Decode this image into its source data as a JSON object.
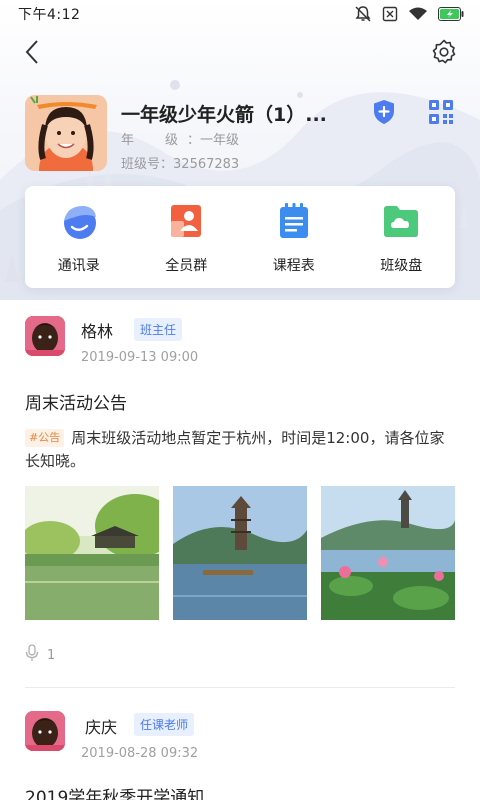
{
  "status_bar": {
    "time": "下午4:12",
    "icons": [
      "mute-icon",
      "no-sim-icon",
      "wifi-icon",
      "battery-charging-icon"
    ]
  },
  "header": {
    "back_icon": "chevron-left-icon",
    "settings_icon": "gear-icon"
  },
  "class_info": {
    "title": "一年级少年火箭（1）...",
    "grade_label": "年　级",
    "grade_value": "一年级",
    "number_label": "班级号",
    "number_value": "32567283",
    "shield_icon": "shield-plus-icon",
    "qr_icon": "qr-code-icon"
  },
  "quick_menu": [
    {
      "label": "通讯录",
      "icon": "contacts-icon",
      "color": "#4d7cf0"
    },
    {
      "label": "全员群",
      "icon": "group-chat-icon",
      "color": "#f2603f"
    },
    {
      "label": "课程表",
      "icon": "schedule-icon",
      "color": "#3c8df0"
    },
    {
      "label": "班级盘",
      "icon": "cloud-folder-icon",
      "color": "#4cc97a"
    }
  ],
  "posts": [
    {
      "author": "格林",
      "role": "班主任",
      "time": "2019-09-13 09:00",
      "title": "周末活动公告",
      "tag": "#公告",
      "body": "周末班级活动地点暂定于杭州，时间是12:00，请各位家长知晓。",
      "voice_count": "1"
    },
    {
      "author": "庆庆",
      "role": "任课老师",
      "time": "2019-08-28 09:32",
      "title": "2019学年秋季开学通知"
    }
  ],
  "colors": {
    "accent": "#4d7cf0",
    "tag_orange": "#e9873a",
    "muted_text": "#9a9a9a"
  }
}
